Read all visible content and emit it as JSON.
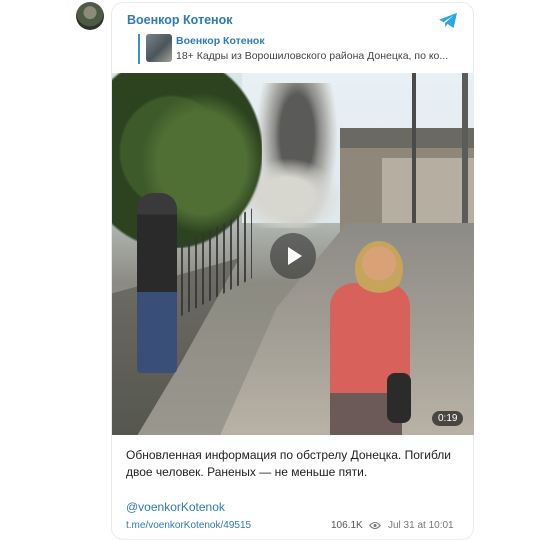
{
  "channel": {
    "name": "Военкор Котенок",
    "avatar_icon": "channel-avatar",
    "platform_icon": "telegram-icon"
  },
  "reply": {
    "author": "Военкор Котенок",
    "text": "18+ Кадры из Ворошиловского района Донецка, по ко..."
  },
  "video": {
    "duration": "0:19",
    "play_icon": "play-icon"
  },
  "post": {
    "text": "Обновленная информация по обстрелу Донецка. Погибли двое человек. Раненых — не меньше пяти.",
    "mention": "@voenkorKotenok"
  },
  "footer": {
    "link": "t.me/voenkorKotenok/49515",
    "views": "106.1K",
    "timestamp": "Jul 31 at 10:01"
  },
  "colors": {
    "accent": "#2f7ab8",
    "telegram": "#2ca5e0"
  }
}
